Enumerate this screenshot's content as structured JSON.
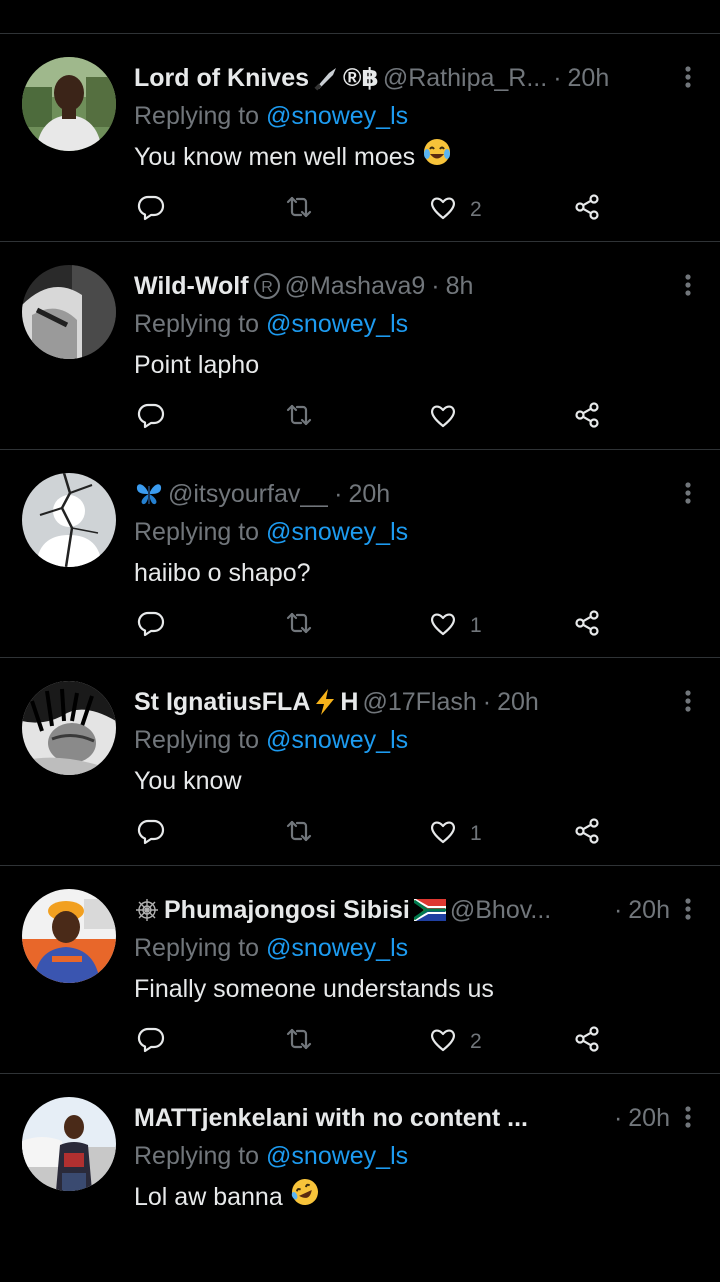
{
  "theme": {
    "background": "#000000",
    "text": "#e7e9ea",
    "secondary": "#71767b",
    "accent": "#1d9bf0",
    "divider": "#2f3336"
  },
  "tweets": [
    {
      "name": "Lord of Knives",
      "name_glyphs": [
        "knife-emoji",
        "registered-sign",
        "baht-sign"
      ],
      "name_suffix": "®฿",
      "handle": "@Rathipa_R...",
      "dot": "·",
      "time": "20h",
      "reply_prefix": "Replying to",
      "reply_to": "@snowey_ls",
      "text": "You know men well moes",
      "text_emoji": "joy-emoji",
      "likes": "2",
      "avatar": "man-outdoors-photo"
    },
    {
      "name": "Wild-Wolf",
      "name_glyphs": [
        "registered-outline-icon"
      ],
      "handle": "@Mashava9",
      "dot": "·",
      "time": "8h",
      "reply_prefix": "Replying to",
      "reply_to": "@snowey_ls",
      "text": "Point lapho",
      "likes": "",
      "avatar": "grayscale-portrait"
    },
    {
      "name": "",
      "name_glyphs": [
        "butterfly-emoji"
      ],
      "handle": "@itsyourfav__",
      "dot": "·",
      "time": "20h",
      "reply_prefix": "Replying to",
      "reply_to": "@snowey_ls",
      "text": "haiibo o shapo?",
      "likes": "1",
      "avatar": "cracked-default-avatar"
    },
    {
      "name": "St IgnatiusFLA",
      "name_after": "H",
      "name_glyphs": [
        "lightning-emoji"
      ],
      "handle": "@17Flash",
      "dot": "·",
      "time": "20h",
      "reply_prefix": "Replying to",
      "reply_to": "@snowey_ls",
      "text": "You know",
      "likes": "1",
      "avatar": "grayscale-dreadlocks-portrait"
    },
    {
      "name": "Phumajongosi Sibisi",
      "name_glyphs": [
        "spider-web-emoji",
        "south-africa-flag"
      ],
      "handle": "@Bhov...",
      "dot": "·",
      "time": "20h",
      "reply_prefix": "Replying to",
      "reply_to": "@snowey_ls",
      "text": "Finally someone understands us",
      "likes": "2",
      "avatar": "man-orange-hat-photo"
    },
    {
      "name": "MATTjenkelani with no content ...",
      "handle": "",
      "dot": "·",
      "time": "20h",
      "reply_prefix": "Replying to",
      "reply_to": "@snowey_ls",
      "text": "Lol aw banna",
      "text_emoji": "rofl-emoji",
      "likes": "",
      "avatar": "man-by-car-photo"
    }
  ]
}
